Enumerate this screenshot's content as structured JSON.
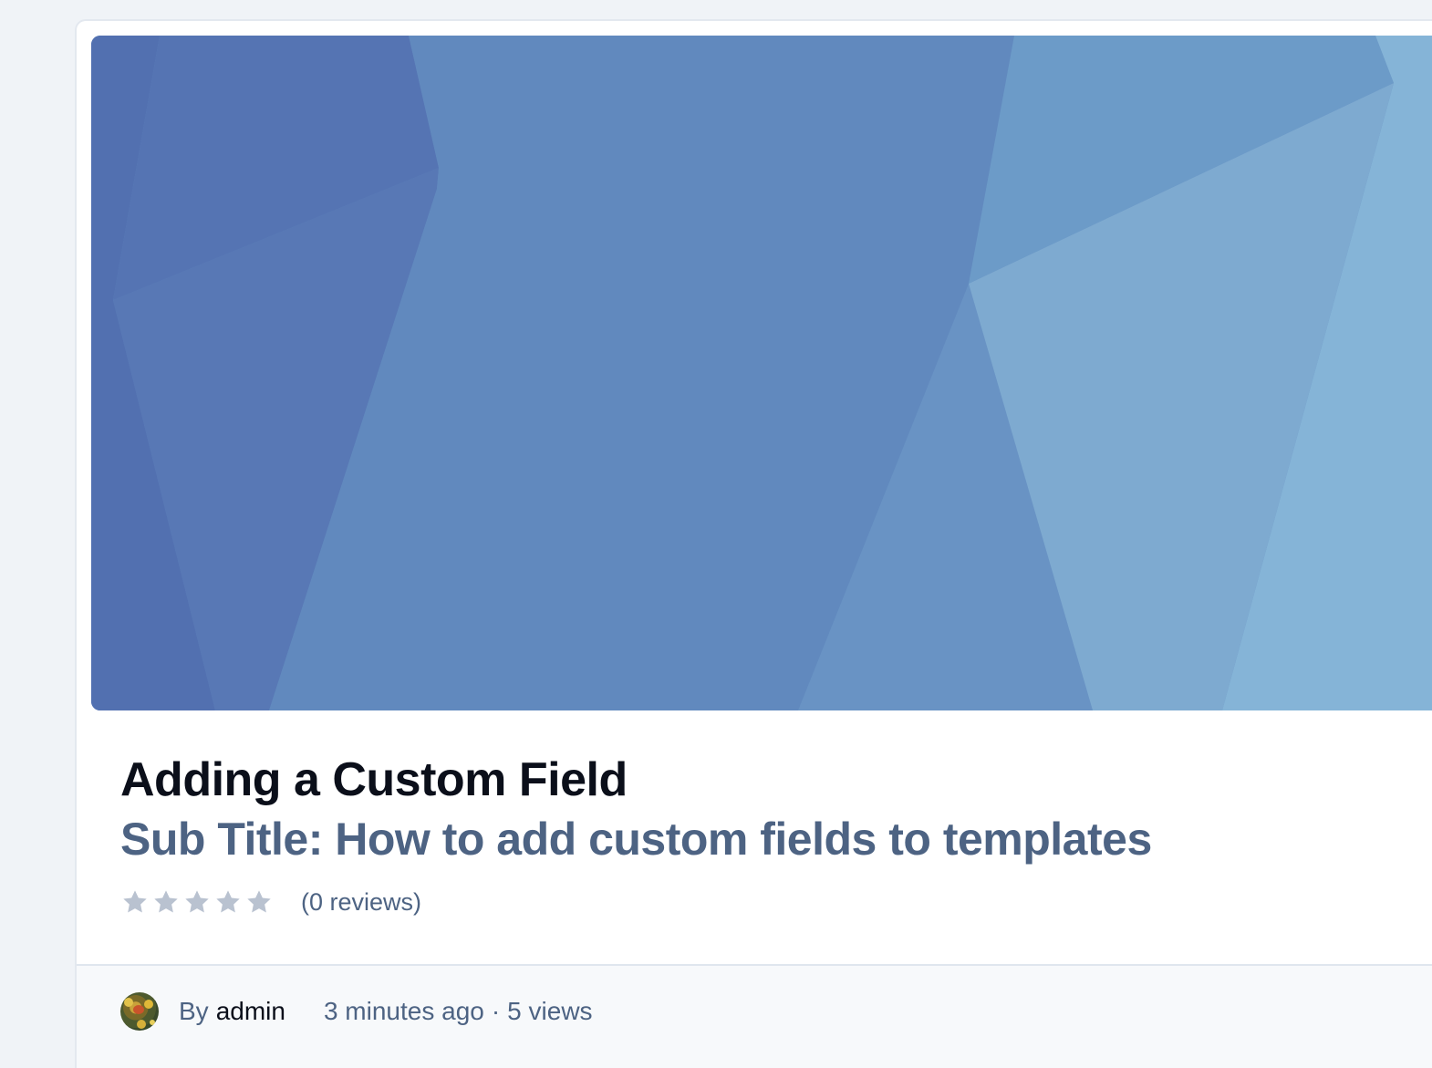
{
  "post": {
    "title": "Adding a Custom Field",
    "subtitle_label": "Sub Title:",
    "subtitle_text": "How to add custom fields to templates",
    "rating": {
      "stars_filled": 0,
      "stars_total": 5,
      "reviews_text": "(0 reviews)"
    },
    "meta": {
      "by_label": "By",
      "author": "admin",
      "time_ago": "3 minutes ago",
      "separator": "·",
      "views": "5 views"
    }
  },
  "colors": {
    "title": "#0b0f1a",
    "subtitle": "#4d6383",
    "star_empty": "#b9c2d0",
    "cover_base": "#6089be"
  },
  "icons": {
    "star": "star-icon",
    "avatar": "user-avatar"
  }
}
